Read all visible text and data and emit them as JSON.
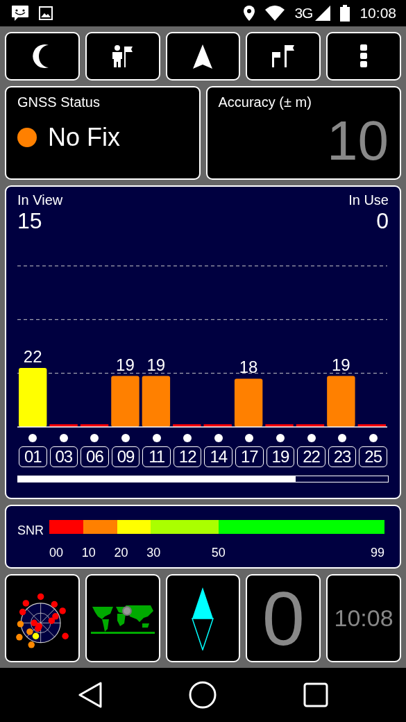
{
  "status_bar": {
    "network": "3G",
    "time": "10:08"
  },
  "toolbar": [
    {
      "kind": "night"
    },
    {
      "kind": "person-flag"
    },
    {
      "kind": "navigate"
    },
    {
      "kind": "flags"
    },
    {
      "kind": "more"
    }
  ],
  "gnss_status": {
    "title": "GNSS Status",
    "value": "No Fix",
    "color": "#ff8000"
  },
  "accuracy": {
    "title": "Accuracy (± m)",
    "value": "10"
  },
  "satellites": {
    "in_view_label": "In View",
    "in_view": "15",
    "in_use_label": "In Use",
    "in_use": "0",
    "chart_data": {
      "type": "bar",
      "categories": [
        "01",
        "03",
        "06",
        "09",
        "11",
        "12",
        "14",
        "17",
        "19",
        "22",
        "23",
        "25"
      ],
      "values": [
        22,
        1,
        1,
        19,
        19,
        1,
        1,
        18,
        1,
        1,
        19,
        1
      ],
      "value_labels": [
        "22",
        null,
        null,
        "19",
        "19",
        null,
        null,
        "18",
        null,
        null,
        "19",
        null
      ]
    }
  },
  "snr_legend": {
    "label": "SNR",
    "segments": [
      {
        "color": "#ff0000",
        "label": "00"
      },
      {
        "color": "#ff8000",
        "label": "10"
      },
      {
        "color": "#ffff00",
        "label": "20"
      },
      {
        "color": "#aaff00",
        "label": "30"
      },
      {
        "color": "#00ff00",
        "label": "50"
      }
    ],
    "end_label": "99"
  },
  "tiles": [
    {
      "kind": "radar"
    },
    {
      "kind": "map"
    },
    {
      "kind": "compass"
    },
    {
      "kind": "counter",
      "text": "0"
    },
    {
      "kind": "clock",
      "text": "10:08"
    }
  ],
  "nav_bar": [
    {
      "kind": "back"
    },
    {
      "kind": "home"
    },
    {
      "kind": "recents"
    }
  ]
}
